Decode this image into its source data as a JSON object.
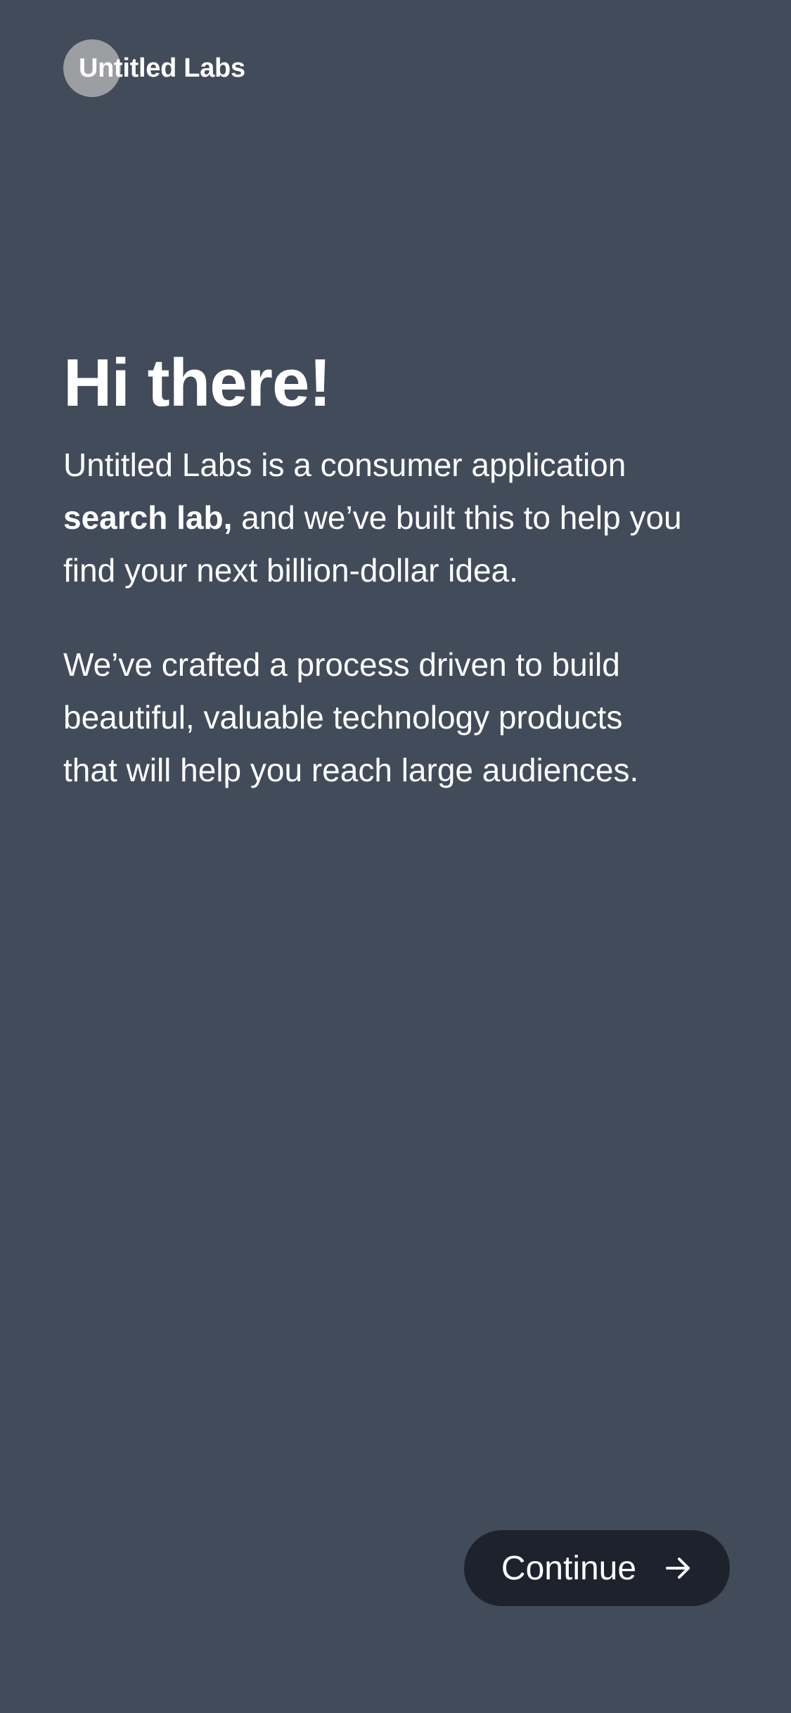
{
  "brand": {
    "name": "Untitled Labs"
  },
  "intro": {
    "title": "Hi there!",
    "paragraph1_before": "Untitled Labs is a consumer application ",
    "paragraph1_bold": "search lab,",
    "paragraph1_after": " and we’ve built this to help you find your next billion-dollar idea.",
    "paragraph2": "We’ve crafted a process driven to build beautiful, valuable technology products that will help you reach large audiences."
  },
  "actions": {
    "continue_label": "Continue",
    "continue_icon": "arrow-right-icon"
  },
  "colors": {
    "background": "#424b5a",
    "button": "#1e222d",
    "logo_mark": "#9c9ea2",
    "text": "#ffffff"
  }
}
